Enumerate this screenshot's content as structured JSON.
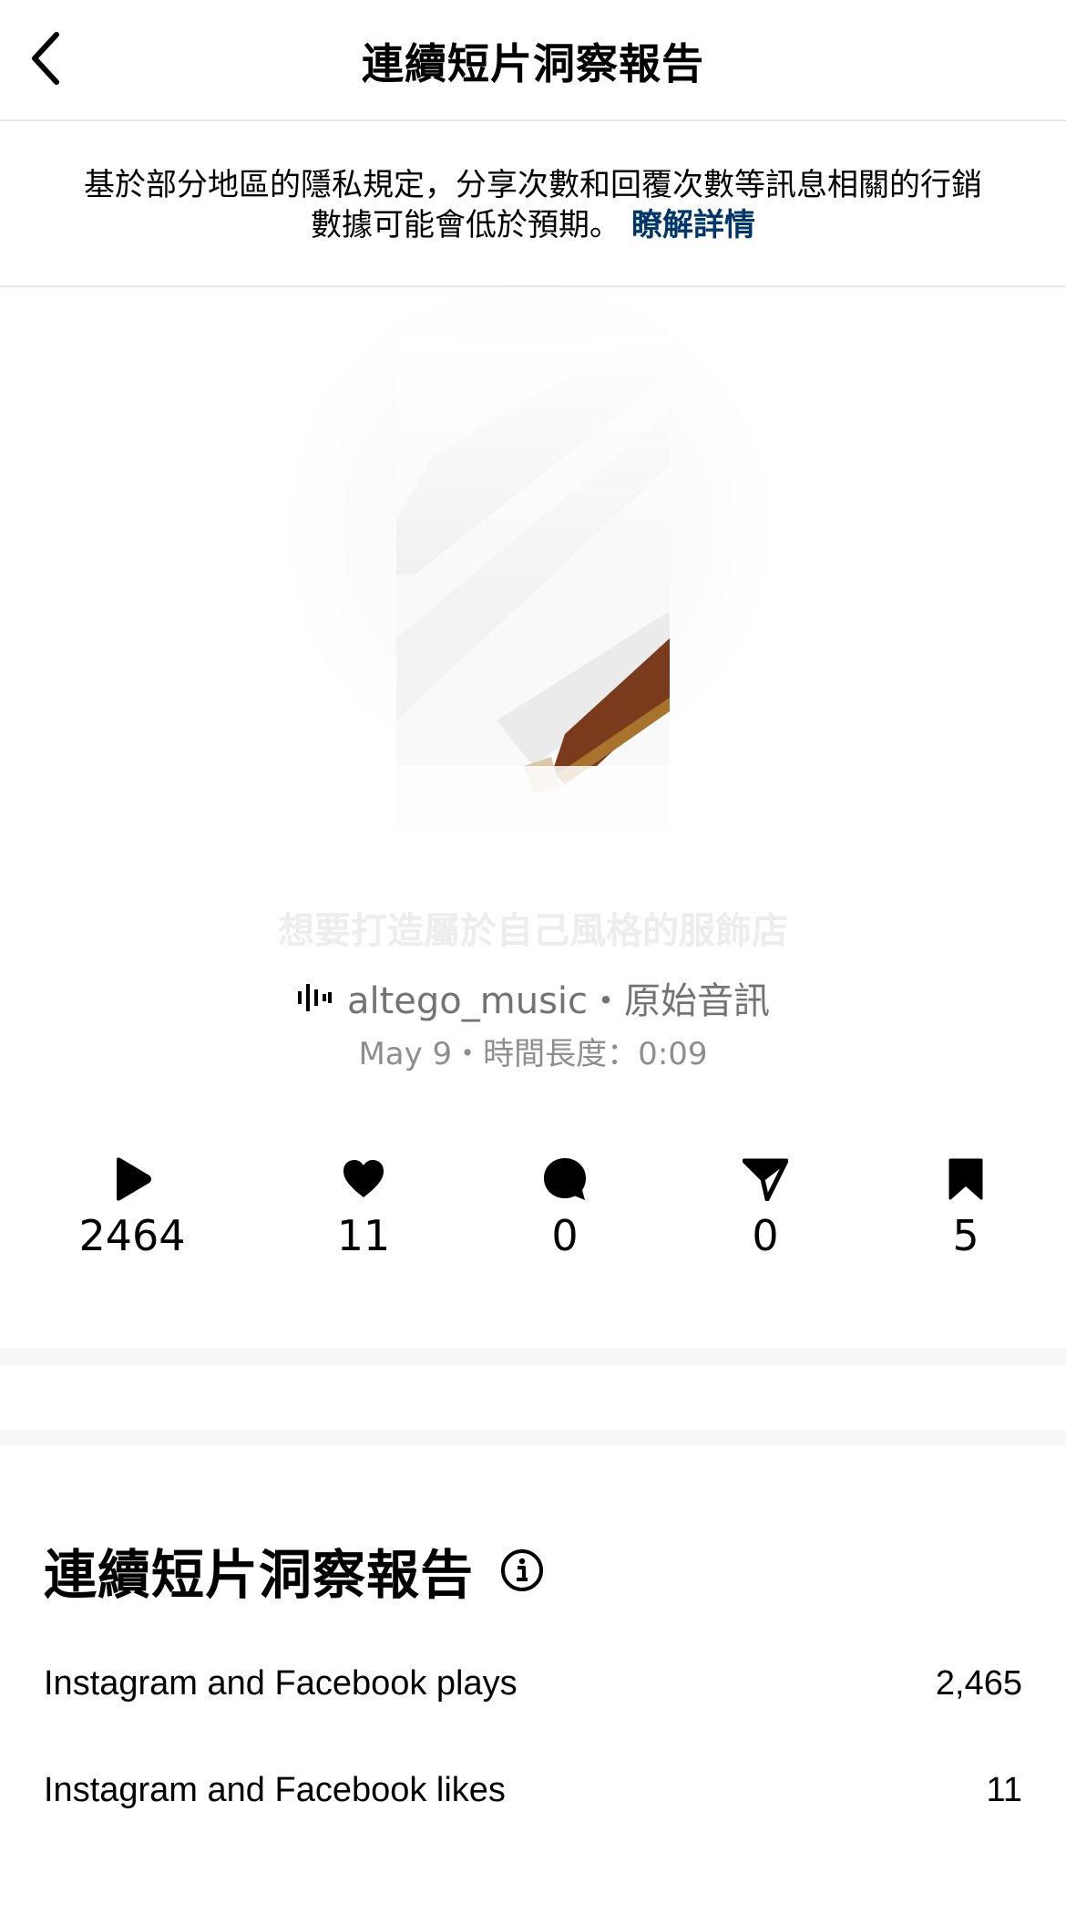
{
  "header": {
    "title": "連續短片洞察報告",
    "back_icon": "chevron-left-icon"
  },
  "notice": {
    "text": "基於部分地區的隱私規定，分享次數和回覆次數等訊息相關的行銷數據可能會低於預期。",
    "link_label": "瞭解詳情",
    "link_color": "#00376b"
  },
  "reel": {
    "caption": "想要打造屬於自己風格的服飾店",
    "audio": {
      "icon": "audio-waveform-icon",
      "text": "altego_music・原始音訊"
    },
    "meta": "May 9・時間長度：0:09"
  },
  "stats": [
    {
      "icon": "play-icon",
      "value": "2464"
    },
    {
      "icon": "heart-icon",
      "value": "11"
    },
    {
      "icon": "comment-icon",
      "value": "0"
    },
    {
      "icon": "share-icon",
      "value": "0"
    },
    {
      "icon": "bookmark-icon",
      "value": "5"
    }
  ],
  "insights": {
    "title": "連續短片洞察報告",
    "info_icon": "info-icon",
    "rows": [
      {
        "label": "Instagram and Facebook plays",
        "value": "2,465"
      },
      {
        "label": "Instagram and Facebook likes",
        "value": "11"
      }
    ]
  }
}
